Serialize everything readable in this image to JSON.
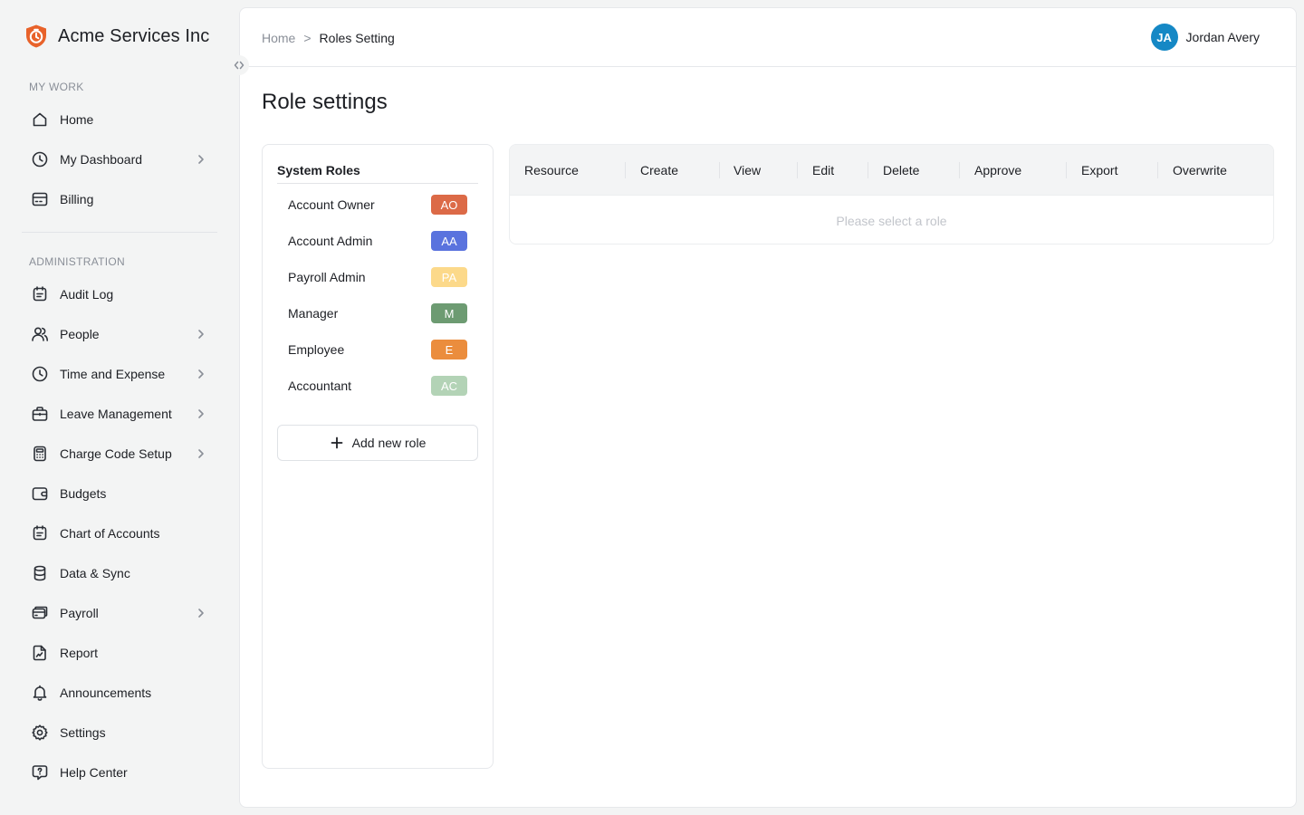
{
  "brand": {
    "name": "Acme Services Inc",
    "logo_color": "#e8622a"
  },
  "sidebar": {
    "my_work_label": "MY WORK",
    "my_work_items": [
      {
        "label": "Home",
        "icon": "home-icon"
      },
      {
        "label": "My Dashboard",
        "icon": "clock-icon",
        "has_children": true
      },
      {
        "label": "Billing",
        "icon": "billing-icon"
      }
    ],
    "administration_label": "ADMINISTRATION",
    "admin_items": [
      {
        "label": "Audit Log",
        "icon": "audit-log-icon"
      },
      {
        "label": "People",
        "icon": "people-icon",
        "has_children": true
      },
      {
        "label": "Time and Expense",
        "icon": "clock-icon",
        "has_children": true
      },
      {
        "label": "Leave Management",
        "icon": "briefcase-icon",
        "has_children": true
      },
      {
        "label": "Charge Code Setup",
        "icon": "calculator-icon",
        "has_children": true
      },
      {
        "label": "Budgets",
        "icon": "wallet-icon"
      },
      {
        "label": "Chart of Accounts",
        "icon": "chart-of-accounts-icon"
      },
      {
        "label": "Data & Sync",
        "icon": "database-icon"
      },
      {
        "label": "Payroll",
        "icon": "payroll-icon",
        "has_children": true
      },
      {
        "label": "Report",
        "icon": "report-icon"
      },
      {
        "label": "Announcements",
        "icon": "bell-icon"
      },
      {
        "label": "Settings",
        "icon": "gear-icon"
      },
      {
        "label": "Help Center",
        "icon": "help-icon"
      }
    ]
  },
  "header": {
    "breadcrumb": {
      "home": "Home",
      "separator": ">",
      "current": "Roles Setting"
    },
    "user": {
      "initials": "JA",
      "name": "Jordan Avery",
      "avatar_color": "#1588c5"
    }
  },
  "page": {
    "title": "Role settings"
  },
  "roles": {
    "title": "System Roles",
    "items": [
      {
        "name": "Account Owner",
        "badge": "AO",
        "color": "#dc6a47"
      },
      {
        "name": "Account Admin",
        "badge": "AA",
        "color": "#5a73de"
      },
      {
        "name": "Payroll Admin",
        "badge": "PA",
        "color": "#fcd98a"
      },
      {
        "name": "Manager",
        "badge": "M",
        "color": "#6d9b72"
      },
      {
        "name": "Employee",
        "badge": "E",
        "color": "#eb8d3d"
      },
      {
        "name": "Accountant",
        "badge": "AC",
        "color": "#b3d3b6"
      }
    ],
    "add_label": "Add new role"
  },
  "permissions": {
    "columns": [
      "Resource",
      "Create",
      "View",
      "Edit",
      "Delete",
      "Approve",
      "Export",
      "Overwrite"
    ],
    "empty_text": "Please select a role"
  }
}
